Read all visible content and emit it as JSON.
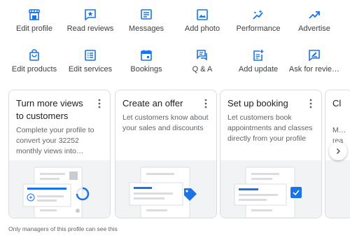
{
  "colors": {
    "accent": "#1a73e8",
    "text": "#202124",
    "muted": "#5f6368",
    "art_bg": "#f1f3f4"
  },
  "actions": [
    {
      "label": "Edit profile",
      "icon": "storefront-icon"
    },
    {
      "label": "Read reviews",
      "icon": "star-review-icon"
    },
    {
      "label": "Messages",
      "icon": "message-icon"
    },
    {
      "label": "Add photo",
      "icon": "photo-icon"
    },
    {
      "label": "Performance",
      "icon": "trending-sparkle-icon"
    },
    {
      "label": "Advertise",
      "icon": "trending-up-icon"
    },
    {
      "label": "Edit products",
      "icon": "shopping-bag-icon"
    },
    {
      "label": "Edit services",
      "icon": "list-icon"
    },
    {
      "label": "Bookings",
      "icon": "calendar-icon"
    },
    {
      "label": "Q & A",
      "icon": "qa-icon"
    },
    {
      "label": "Add update",
      "icon": "post-add-icon"
    },
    {
      "label": "Ask for revie…",
      "icon": "rate-review-icon"
    }
  ],
  "cards": [
    {
      "title": "Turn more views to customers",
      "description": "Complete your profile to convert your 32252 monthly views into…"
    },
    {
      "title": "Create an offer",
      "description": "Let customers know about your sales and discounts"
    },
    {
      "title": "Set up booking",
      "description": "Let customers book appointments and classes directly from your profile"
    },
    {
      "title": "Cl",
      "description": "M… rea"
    }
  ],
  "footer_text": "Only managers of this profile can see this"
}
